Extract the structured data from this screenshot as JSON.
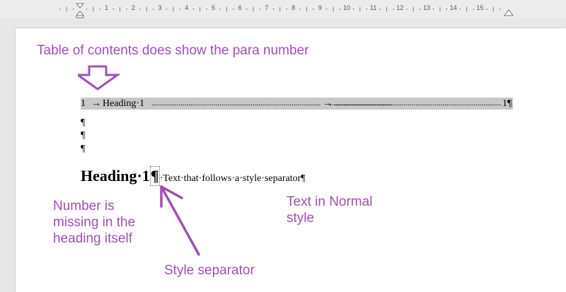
{
  "ruler": {
    "numbers": [
      "1",
      "2",
      "3",
      "4",
      "5",
      "6",
      "7",
      "8",
      "9",
      "10",
      "11",
      "12",
      "13",
      "14",
      "15"
    ]
  },
  "annotations": {
    "top": "Table of contents does show the para number",
    "missing_number": "Number is missing in the heading itself",
    "style_separator": "Style separator",
    "normal_style": "Text in Normal style"
  },
  "toc": {
    "number": "1",
    "arrow1": "→",
    "title": "Heading·1",
    "arrow2": "→",
    "page": "1¶",
    "leader": "................................................................................................................................................................"
  },
  "document": {
    "empty_paragraphs": [
      "¶",
      "¶",
      "¶"
    ],
    "heading_text": "Heading·1",
    "separator_mark": "¶",
    "normal_text": "·Text·that·follows·a·style·separator¶"
  },
  "colors": {
    "annotation": "#9f4fb3",
    "toc_highlight": "#c8c8c8"
  }
}
